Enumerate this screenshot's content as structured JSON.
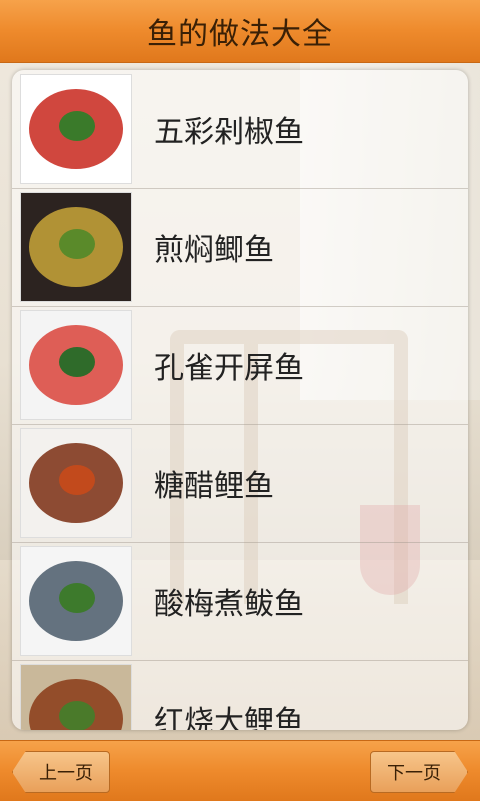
{
  "header": {
    "title": "鱼的做法大全"
  },
  "list": {
    "items": [
      {
        "label": "五彩剁椒鱼",
        "thumb_colors": [
          "#ffffff",
          "#c8271c",
          "#3a7a2a"
        ]
      },
      {
        "label": "煎焖鲫鱼",
        "thumb_colors": [
          "#2c2320",
          "#c9a63a",
          "#5a8a2a"
        ]
      },
      {
        "label": "孔雀开屏鱼",
        "thumb_colors": [
          "#f4f4f4",
          "#d9433a",
          "#2f6b2a"
        ]
      },
      {
        "label": "糖醋鲤鱼",
        "thumb_colors": [
          "#f3f1ee",
          "#7a2e12",
          "#c24a1c"
        ]
      },
      {
        "label": "酸梅煮鲅鱼",
        "thumb_colors": [
          "#f5f5f5",
          "#4a5a6a",
          "#3d7a2c"
        ]
      },
      {
        "label": "红烧大鲤鱼",
        "thumb_colors": [
          "#c9b89a",
          "#8a3a16",
          "#4a7a2a"
        ]
      }
    ]
  },
  "footer": {
    "prev_label": "上一页",
    "next_label": "下一页"
  },
  "colors": {
    "header_orange": "#ee8a2c",
    "title_text": "#3a2006"
  }
}
